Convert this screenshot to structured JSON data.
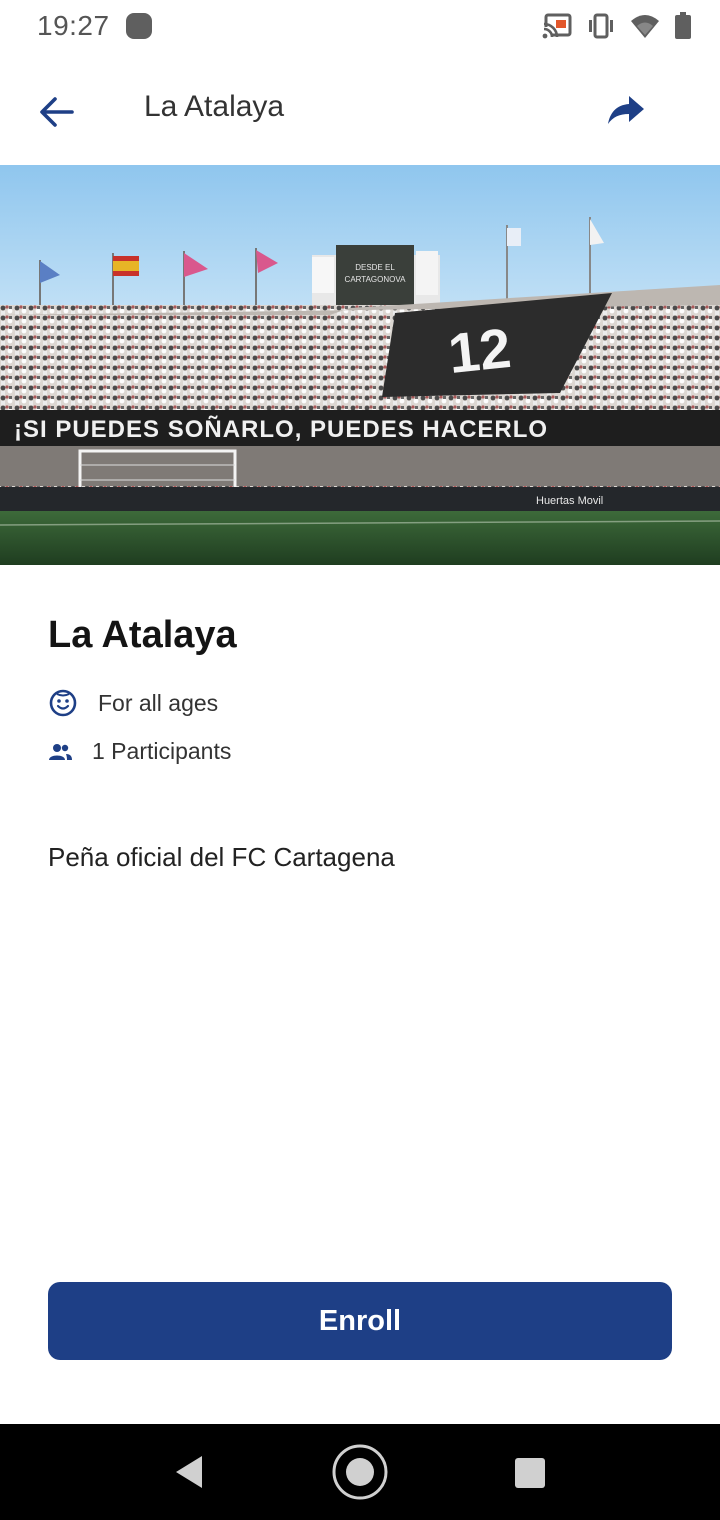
{
  "status_bar": {
    "time": "19:27",
    "icons": [
      "notification-dot-icon",
      "cast-icon",
      "vibrate-icon",
      "wifi-icon",
      "battery-icon"
    ]
  },
  "app_bar": {
    "title": "La Atalaya",
    "back_icon": "arrow-back-icon",
    "share_icon": "share-icon"
  },
  "hero": {
    "image": "stadium crowd photo",
    "banner_text": "¡SI PUEDES SOÑARLO, PUEDES HACERLO",
    "flag_number": "12",
    "scoreboard_text_line1": "DESDE EL",
    "scoreboard_text_line2": "CARTAGONOVA",
    "ad_text": "Huertas Movil"
  },
  "event": {
    "title": "La Atalaya",
    "ages_label": "For all ages",
    "participants_label": "1 Participants",
    "description": "Peña oficial del FC Cartagena"
  },
  "actions": {
    "enroll_label": "Enroll"
  },
  "colors": {
    "primary": "#1e3f86",
    "icon_blue": "#1e3f86",
    "text_dark": "#141414"
  },
  "nav_bar": {
    "items": [
      "nav-back-icon",
      "nav-home-icon",
      "nav-recents-icon"
    ]
  }
}
